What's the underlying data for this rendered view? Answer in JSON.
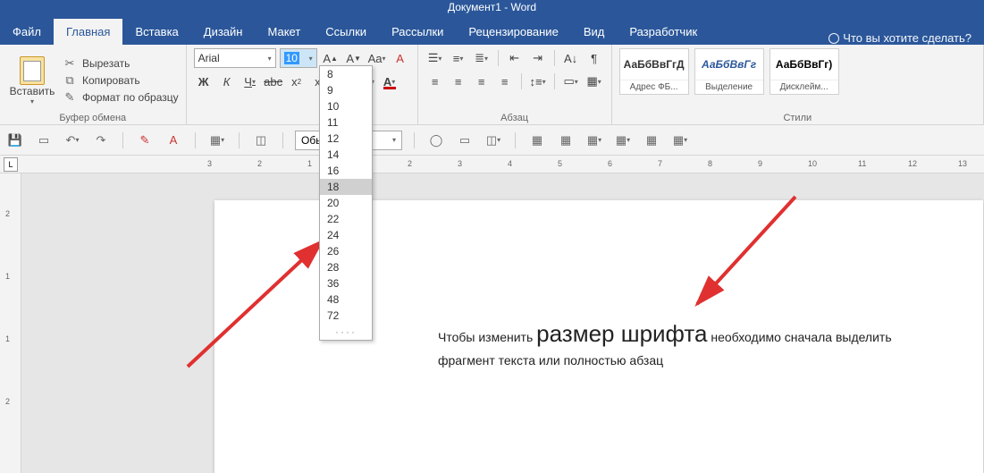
{
  "title": "Документ1 - Word",
  "tabs": [
    "Файл",
    "Главная",
    "Вставка",
    "Дизайн",
    "Макет",
    "Ссылки",
    "Рассылки",
    "Рецензирование",
    "Вид",
    "Разработчик"
  ],
  "active_tab": 1,
  "tell_me": "Что вы хотите сделать?",
  "clipboard": {
    "paste": "Вставить",
    "cut": "Вырезать",
    "copy": "Копировать",
    "format_painter": "Формат по образцу",
    "group_label": "Буфер обмена"
  },
  "font": {
    "name": "Arial",
    "size": "10",
    "sizes": [
      "8",
      "9",
      "10",
      "11",
      "12",
      "14",
      "16",
      "18",
      "20",
      "22",
      "24",
      "26",
      "28",
      "36",
      "48",
      "72"
    ],
    "highlighted_size": "18"
  },
  "paragraph": {
    "group_label": "Абзац"
  },
  "styles": {
    "group_label": "Стили",
    "items": [
      {
        "preview": "АаБбВвГгД",
        "name": "Адрес ФБ..."
      },
      {
        "preview": "АаБбВвГг",
        "name": "Выделение"
      },
      {
        "preview": "АаБбВвГг)",
        "name": "Дисклейм..."
      }
    ]
  },
  "qat_style": "Обычный",
  "ruler_marks": [
    "3",
    "2",
    "1",
    "1",
    "2",
    "3",
    "4",
    "5",
    "6",
    "7",
    "8",
    "9",
    "10",
    "11",
    "12",
    "13"
  ],
  "vruler_marks": [
    "2",
    "1",
    "1",
    "2"
  ],
  "lbox": "L",
  "doc_text": {
    "part1": "Чтобы изменить ",
    "big": "размер шрифта",
    "part2": " необходимо сначала выделить фрагмент текста или полностью абзац"
  }
}
